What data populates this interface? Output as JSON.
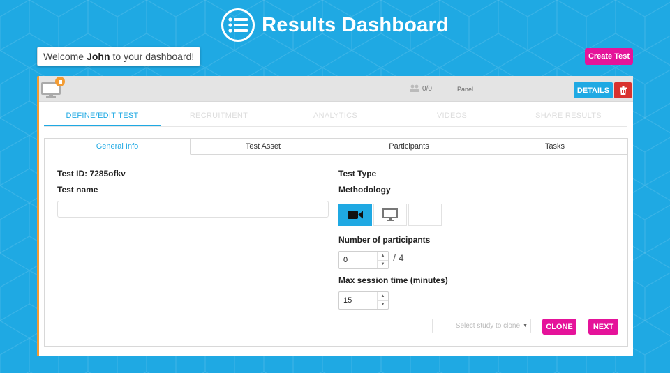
{
  "header": {
    "title": "Results Dashboard",
    "logo_icon": "list-icon"
  },
  "welcome": {
    "prefix": "Welcome",
    "name": "John",
    "suffix": "to your dashboard!"
  },
  "actions": {
    "create_test": "Create Test"
  },
  "card": {
    "device_icon": "monitor-icon",
    "status_color": "#f39c33",
    "participants_count": "0/0",
    "panel_label": "Panel",
    "details_label": "DETAILS",
    "delete_icon": "trash-icon"
  },
  "main_tabs": [
    {
      "label": "DEFINE/EDIT TEST",
      "active": true
    },
    {
      "label": "RECRUITMENT",
      "active": false
    },
    {
      "label": "ANALYTICS",
      "active": false
    },
    {
      "label": "VIDEOS",
      "active": false
    },
    {
      "label": "SHARE RESULTS",
      "active": false
    }
  ],
  "sub_tabs": [
    {
      "label": "General Info",
      "active": true
    },
    {
      "label": "Test Asset",
      "active": false
    },
    {
      "label": "Participants",
      "active": false
    },
    {
      "label": "Tasks",
      "active": false
    }
  ],
  "general_info": {
    "test_id_label": "Test ID: 7285ofkv",
    "test_name_label": "Test name",
    "test_name_value": "",
    "test_type_label": "Test Type",
    "methodology_label": "Methodology",
    "methodology_options": [
      "video-camera-icon",
      "desktop-icon",
      "blank"
    ],
    "participants_label": "Number of participants",
    "participants_value": "0",
    "participants_max": "/ 4",
    "session_label": "Max session time (minutes)",
    "session_value": "15",
    "clone_placeholder": "Select study to clone",
    "clone_button": "CLONE",
    "next_button": "NEXT"
  },
  "colors": {
    "background": "#1fa9e3",
    "accent": "#1fa9e3",
    "pink": "#e5139a",
    "danger": "#d9322e",
    "orange": "#f39c33"
  }
}
